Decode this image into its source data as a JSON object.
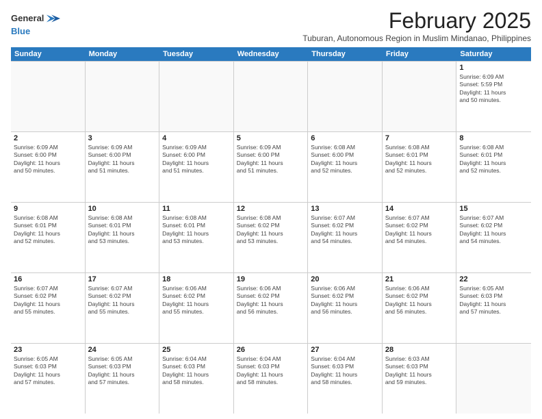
{
  "logo": {
    "line1": "General",
    "line2": "Blue",
    "arrow_color": "#2a7abf"
  },
  "title": "February 2025",
  "subtitle": "Tuburan, Autonomous Region in Muslim Mindanao, Philippines",
  "header": {
    "days": [
      "Sunday",
      "Monday",
      "Tuesday",
      "Wednesday",
      "Thursday",
      "Friday",
      "Saturday"
    ]
  },
  "rows": [
    {
      "cells": [
        {
          "day": "",
          "info": ""
        },
        {
          "day": "",
          "info": ""
        },
        {
          "day": "",
          "info": ""
        },
        {
          "day": "",
          "info": ""
        },
        {
          "day": "",
          "info": ""
        },
        {
          "day": "",
          "info": ""
        },
        {
          "day": "1",
          "info": "Sunrise: 6:09 AM\nSunset: 5:59 PM\nDaylight: 11 hours\nand 50 minutes."
        }
      ]
    },
    {
      "cells": [
        {
          "day": "2",
          "info": "Sunrise: 6:09 AM\nSunset: 6:00 PM\nDaylight: 11 hours\nand 50 minutes."
        },
        {
          "day": "3",
          "info": "Sunrise: 6:09 AM\nSunset: 6:00 PM\nDaylight: 11 hours\nand 51 minutes."
        },
        {
          "day": "4",
          "info": "Sunrise: 6:09 AM\nSunset: 6:00 PM\nDaylight: 11 hours\nand 51 minutes."
        },
        {
          "day": "5",
          "info": "Sunrise: 6:09 AM\nSunset: 6:00 PM\nDaylight: 11 hours\nand 51 minutes."
        },
        {
          "day": "6",
          "info": "Sunrise: 6:08 AM\nSunset: 6:00 PM\nDaylight: 11 hours\nand 52 minutes."
        },
        {
          "day": "7",
          "info": "Sunrise: 6:08 AM\nSunset: 6:01 PM\nDaylight: 11 hours\nand 52 minutes."
        },
        {
          "day": "8",
          "info": "Sunrise: 6:08 AM\nSunset: 6:01 PM\nDaylight: 11 hours\nand 52 minutes."
        }
      ]
    },
    {
      "cells": [
        {
          "day": "9",
          "info": "Sunrise: 6:08 AM\nSunset: 6:01 PM\nDaylight: 11 hours\nand 52 minutes."
        },
        {
          "day": "10",
          "info": "Sunrise: 6:08 AM\nSunset: 6:01 PM\nDaylight: 11 hours\nand 53 minutes."
        },
        {
          "day": "11",
          "info": "Sunrise: 6:08 AM\nSunset: 6:01 PM\nDaylight: 11 hours\nand 53 minutes."
        },
        {
          "day": "12",
          "info": "Sunrise: 6:08 AM\nSunset: 6:02 PM\nDaylight: 11 hours\nand 53 minutes."
        },
        {
          "day": "13",
          "info": "Sunrise: 6:07 AM\nSunset: 6:02 PM\nDaylight: 11 hours\nand 54 minutes."
        },
        {
          "day": "14",
          "info": "Sunrise: 6:07 AM\nSunset: 6:02 PM\nDaylight: 11 hours\nand 54 minutes."
        },
        {
          "day": "15",
          "info": "Sunrise: 6:07 AM\nSunset: 6:02 PM\nDaylight: 11 hours\nand 54 minutes."
        }
      ]
    },
    {
      "cells": [
        {
          "day": "16",
          "info": "Sunrise: 6:07 AM\nSunset: 6:02 PM\nDaylight: 11 hours\nand 55 minutes."
        },
        {
          "day": "17",
          "info": "Sunrise: 6:07 AM\nSunset: 6:02 PM\nDaylight: 11 hours\nand 55 minutes."
        },
        {
          "day": "18",
          "info": "Sunrise: 6:06 AM\nSunset: 6:02 PM\nDaylight: 11 hours\nand 55 minutes."
        },
        {
          "day": "19",
          "info": "Sunrise: 6:06 AM\nSunset: 6:02 PM\nDaylight: 11 hours\nand 56 minutes."
        },
        {
          "day": "20",
          "info": "Sunrise: 6:06 AM\nSunset: 6:02 PM\nDaylight: 11 hours\nand 56 minutes."
        },
        {
          "day": "21",
          "info": "Sunrise: 6:06 AM\nSunset: 6:02 PM\nDaylight: 11 hours\nand 56 minutes."
        },
        {
          "day": "22",
          "info": "Sunrise: 6:05 AM\nSunset: 6:03 PM\nDaylight: 11 hours\nand 57 minutes."
        }
      ]
    },
    {
      "cells": [
        {
          "day": "23",
          "info": "Sunrise: 6:05 AM\nSunset: 6:03 PM\nDaylight: 11 hours\nand 57 minutes."
        },
        {
          "day": "24",
          "info": "Sunrise: 6:05 AM\nSunset: 6:03 PM\nDaylight: 11 hours\nand 57 minutes."
        },
        {
          "day": "25",
          "info": "Sunrise: 6:04 AM\nSunset: 6:03 PM\nDaylight: 11 hours\nand 58 minutes."
        },
        {
          "day": "26",
          "info": "Sunrise: 6:04 AM\nSunset: 6:03 PM\nDaylight: 11 hours\nand 58 minutes."
        },
        {
          "day": "27",
          "info": "Sunrise: 6:04 AM\nSunset: 6:03 PM\nDaylight: 11 hours\nand 58 minutes."
        },
        {
          "day": "28",
          "info": "Sunrise: 6:03 AM\nSunset: 6:03 PM\nDaylight: 11 hours\nand 59 minutes."
        },
        {
          "day": "",
          "info": ""
        }
      ]
    }
  ]
}
